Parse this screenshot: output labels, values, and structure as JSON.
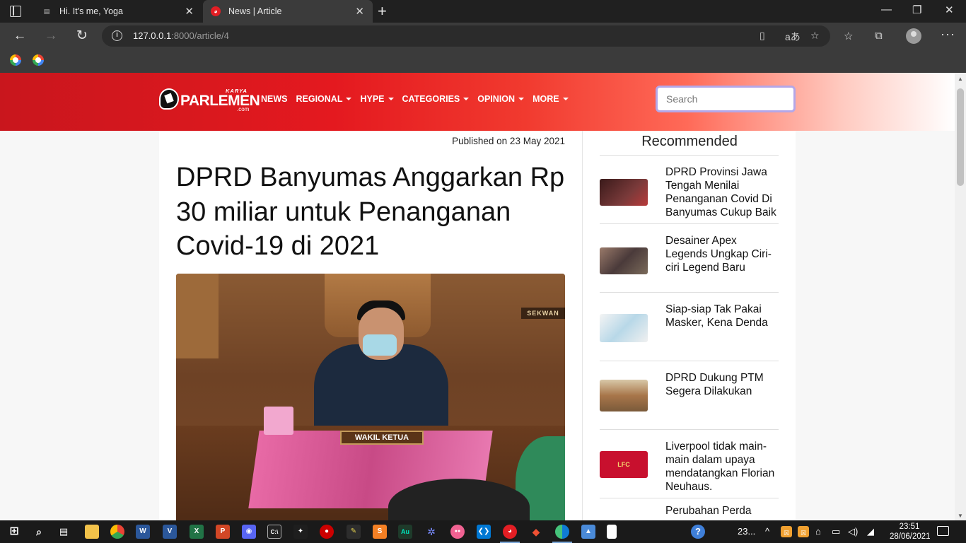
{
  "browser": {
    "tabs": [
      {
        "title": "Hi. It's me, Yoga",
        "active": false,
        "favicon": "page-icon"
      },
      {
        "title": "News | Article",
        "active": true,
        "favicon": "karya-parlemen-icon"
      }
    ],
    "address": {
      "host": "127.0.0.1",
      "rest": ":8000/article/4"
    },
    "favorites": [
      {
        "icon": "google-icon"
      },
      {
        "icon": "google-icon"
      }
    ]
  },
  "site": {
    "logo": {
      "word": "PARLEMEN",
      "karya": "KARYA",
      "com": ".com"
    },
    "nav": [
      {
        "label": "NEWS",
        "dropdown": false
      },
      {
        "label": "REGIONAL",
        "dropdown": true
      },
      {
        "label": "HYPE",
        "dropdown": true
      },
      {
        "label": "CATEGORIES",
        "dropdown": true
      },
      {
        "label": "OPINION",
        "dropdown": true
      },
      {
        "label": "MORE",
        "dropdown": true
      }
    ],
    "search_placeholder": "Search",
    "colors": {
      "header_start": "#c9161d",
      "header_end": "#ffffff",
      "search_border": "#b4a7e8"
    }
  },
  "article": {
    "published": "Published on 23 May 2021",
    "headline": "DPRD Banyumas Anggarkan Rp 30 miliar untuk Penanganan Covid-19 di 2021",
    "photo_text": {
      "nameplate": "WAKIL KETUA",
      "sign": "SEKWAN"
    }
  },
  "recommended": {
    "title": "Recommended",
    "items": [
      {
        "text": "DPRD Provinsi Jawa Tengah Menilai Penanganan Covid Di Banyumas Cukup Baik",
        "thumb_color": "#5a2b2b"
      },
      {
        "text": "Desainer Apex Legends Ungkap Ciri-ciri Legend Baru",
        "thumb_color": "#6e5a4a"
      },
      {
        "text": "Siap-siap Tak Pakai Masker, Kena Denda",
        "thumb_color": "#e8eef0"
      },
      {
        "text": "DPRD Dukung PTM Segera Dilakukan",
        "thumb_color": "#a8764a"
      },
      {
        "text": "Liverpool tidak main-main dalam upaya mendatangkan Florian Neuhaus.",
        "thumb_color": "#c8102e"
      },
      {
        "text": "Perubahan Perda",
        "thumb_color": "#8a6a4a"
      }
    ]
  },
  "taskbar": {
    "weather": "23...",
    "time": "23:51",
    "date": "28/06/2021"
  }
}
